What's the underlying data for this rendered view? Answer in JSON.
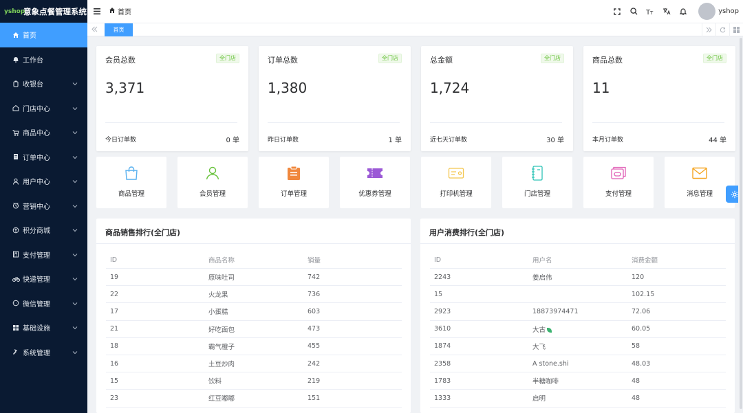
{
  "app": {
    "logo_text": "yshop",
    "title": "意象点餐管理系统"
  },
  "sidebar": {
    "items": [
      {
        "label": "首页",
        "icon": "home-icon",
        "active": true,
        "has_arrow": false
      },
      {
        "label": "工作台",
        "icon": "bell-icon",
        "active": false,
        "has_arrow": false
      },
      {
        "label": "收银台",
        "icon": "cashier-icon",
        "active": false,
        "has_arrow": true
      },
      {
        "label": "门店中心",
        "icon": "store-icon",
        "active": false,
        "has_arrow": true
      },
      {
        "label": "商品中心",
        "icon": "cart-icon",
        "active": false,
        "has_arrow": true
      },
      {
        "label": "订单中心",
        "icon": "order-icon",
        "active": false,
        "has_arrow": true
      },
      {
        "label": "用户中心",
        "icon": "user-icon",
        "active": false,
        "has_arrow": true
      },
      {
        "label": "营销中心",
        "icon": "clock-icon",
        "active": false,
        "has_arrow": true
      },
      {
        "label": "积分商城",
        "icon": "points-icon",
        "active": false,
        "has_arrow": true
      },
      {
        "label": "支付管理",
        "icon": "calculator-icon",
        "active": false,
        "has_arrow": true
      },
      {
        "label": "快递管理",
        "icon": "bike-icon",
        "active": false,
        "has_arrow": true
      },
      {
        "label": "微信管理",
        "icon": "chat-icon",
        "active": false,
        "has_arrow": true
      },
      {
        "label": "基础设施",
        "icon": "grid-icon",
        "active": false,
        "has_arrow": true
      },
      {
        "label": "系统管理",
        "icon": "hammer-icon",
        "active": false,
        "has_arrow": true
      }
    ]
  },
  "header": {
    "breadcrumb": "首页",
    "username": "yshop"
  },
  "tags": {
    "active_tag": "首页"
  },
  "stats": [
    {
      "title": "会员总数",
      "badge": "全门店",
      "value": "3,371",
      "foot_label": "今日订单数",
      "foot_value": "0 单"
    },
    {
      "title": "订单总数",
      "badge": "全门店",
      "value": "1,380",
      "foot_label": "昨日订单数",
      "foot_value": "1 单"
    },
    {
      "title": "总金额",
      "badge": "全门店",
      "value": "1,724",
      "foot_label": "近七天订单数",
      "foot_value": "30 单"
    },
    {
      "title": "商品总数",
      "badge": "全门店",
      "value": "11",
      "foot_label": "本月订单数",
      "foot_value": "44 单"
    }
  ],
  "quick_entries": [
    {
      "label": "商品管理",
      "icon": "shopping-bag-icon",
      "color": "#5ab1ef"
    },
    {
      "label": "会员管理",
      "icon": "member-icon",
      "color": "#67c23a"
    },
    {
      "label": "订单管理",
      "icon": "clipboard-icon",
      "color": "#f0883e"
    },
    {
      "label": "优惠券管理",
      "icon": "ticket-icon",
      "color": "#9b59d6"
    },
    {
      "label": "打印机管理",
      "icon": "printer-icon",
      "color": "#f3c74f"
    },
    {
      "label": "门店管理",
      "icon": "notebook-icon",
      "color": "#2ec4b6"
    },
    {
      "label": "支付管理",
      "icon": "wallet-icon",
      "color": "#e05db5"
    },
    {
      "label": "消息管理",
      "icon": "mail-icon",
      "color": "#f5a623"
    }
  ],
  "product_rank": {
    "title": "商品销售排行(全门店)",
    "columns": [
      "ID",
      "商品名称",
      "销量"
    ],
    "rows": [
      [
        "19",
        "原味吐司",
        "742"
      ],
      [
        "22",
        "火龙果",
        "736"
      ],
      [
        "17",
        "小蛋糕",
        "603"
      ],
      [
        "21",
        "好吃面包",
        "473"
      ],
      [
        "18",
        "霸气橙子",
        "455"
      ],
      [
        "16",
        "土豆炒肉",
        "242"
      ],
      [
        "15",
        "饮料",
        "219"
      ],
      [
        "23",
        "红豆嘟嘟",
        "151"
      ]
    ]
  },
  "user_rank": {
    "title": "用户消费排行(全门店)",
    "columns": [
      "ID",
      "用户名",
      "消费金额"
    ],
    "rows": [
      [
        "2243",
        "姜启伟",
        "120"
      ],
      [
        "15",
        "",
        "102.15"
      ],
      [
        "2923",
        "18873974471",
        "72.06"
      ],
      [
        "3610",
        "大古",
        "60.05"
      ],
      [
        "1874",
        "大飞",
        "58"
      ],
      [
        "2358",
        "A stone.shi",
        "48.03"
      ],
      [
        "1783",
        "半糖咖啡",
        "48"
      ],
      [
        "1333",
        "启明",
        "48"
      ]
    ]
  },
  "colors": {
    "primary": "#409eff",
    "sidebar_bg": "#0a1a32",
    "badge_green": "#67c23a"
  }
}
